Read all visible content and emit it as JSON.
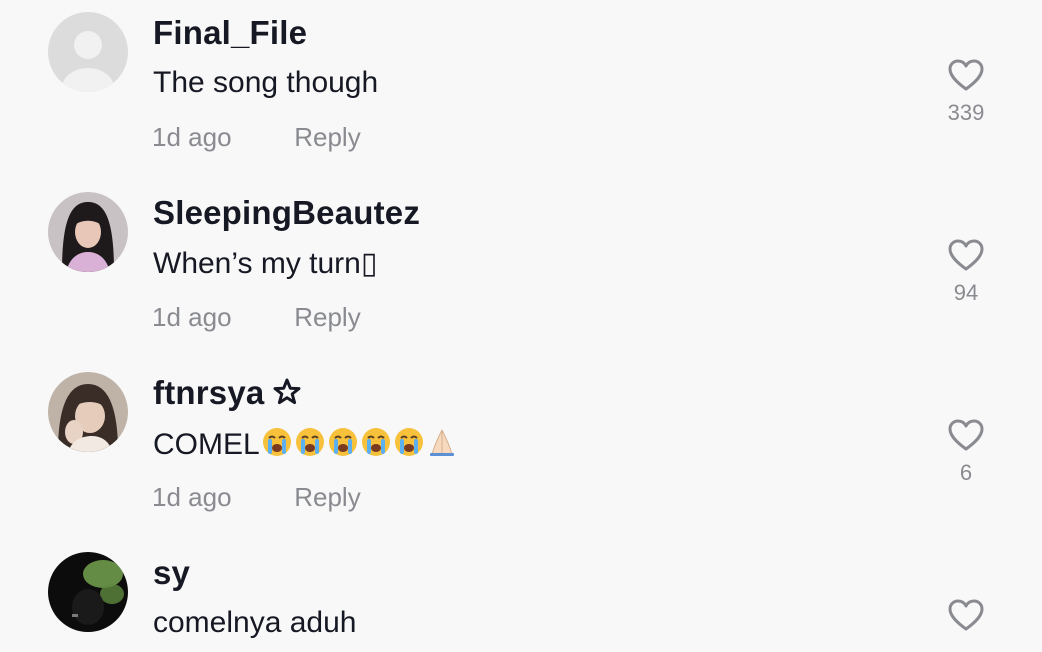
{
  "comments": [
    {
      "username": "Final_File",
      "text": "The song though",
      "time": "1d ago",
      "reply_label": "Reply",
      "likes": "339",
      "avatar": "default-avatar-icon"
    },
    {
      "username": "SleepingBeautez",
      "text": "When’s my turn",
      "text_suffix": "▯",
      "time": "1d ago",
      "reply_label": "Reply",
      "likes": "94",
      "avatar": "user-photo"
    },
    {
      "username": "ftnrsya",
      "username_badge": "star-outline-icon",
      "text": "COMEL",
      "emojis": [
        "loudly-crying-face-icon",
        "loudly-crying-face-icon",
        "loudly-crying-face-icon",
        "loudly-crying-face-icon",
        "loudly-crying-face-icon",
        "folded-hands-icon"
      ],
      "time": "1d ago",
      "reply_label": "Reply",
      "likes": "6",
      "avatar": "user-photo"
    },
    {
      "username": "sy",
      "text": "comelnya aduh",
      "avatar": "user-photo"
    }
  ],
  "colors": {
    "background": "#f8f8f8",
    "primary_text": "#161823",
    "secondary_text": "#8a8b91",
    "icon": "#8a8b91"
  }
}
